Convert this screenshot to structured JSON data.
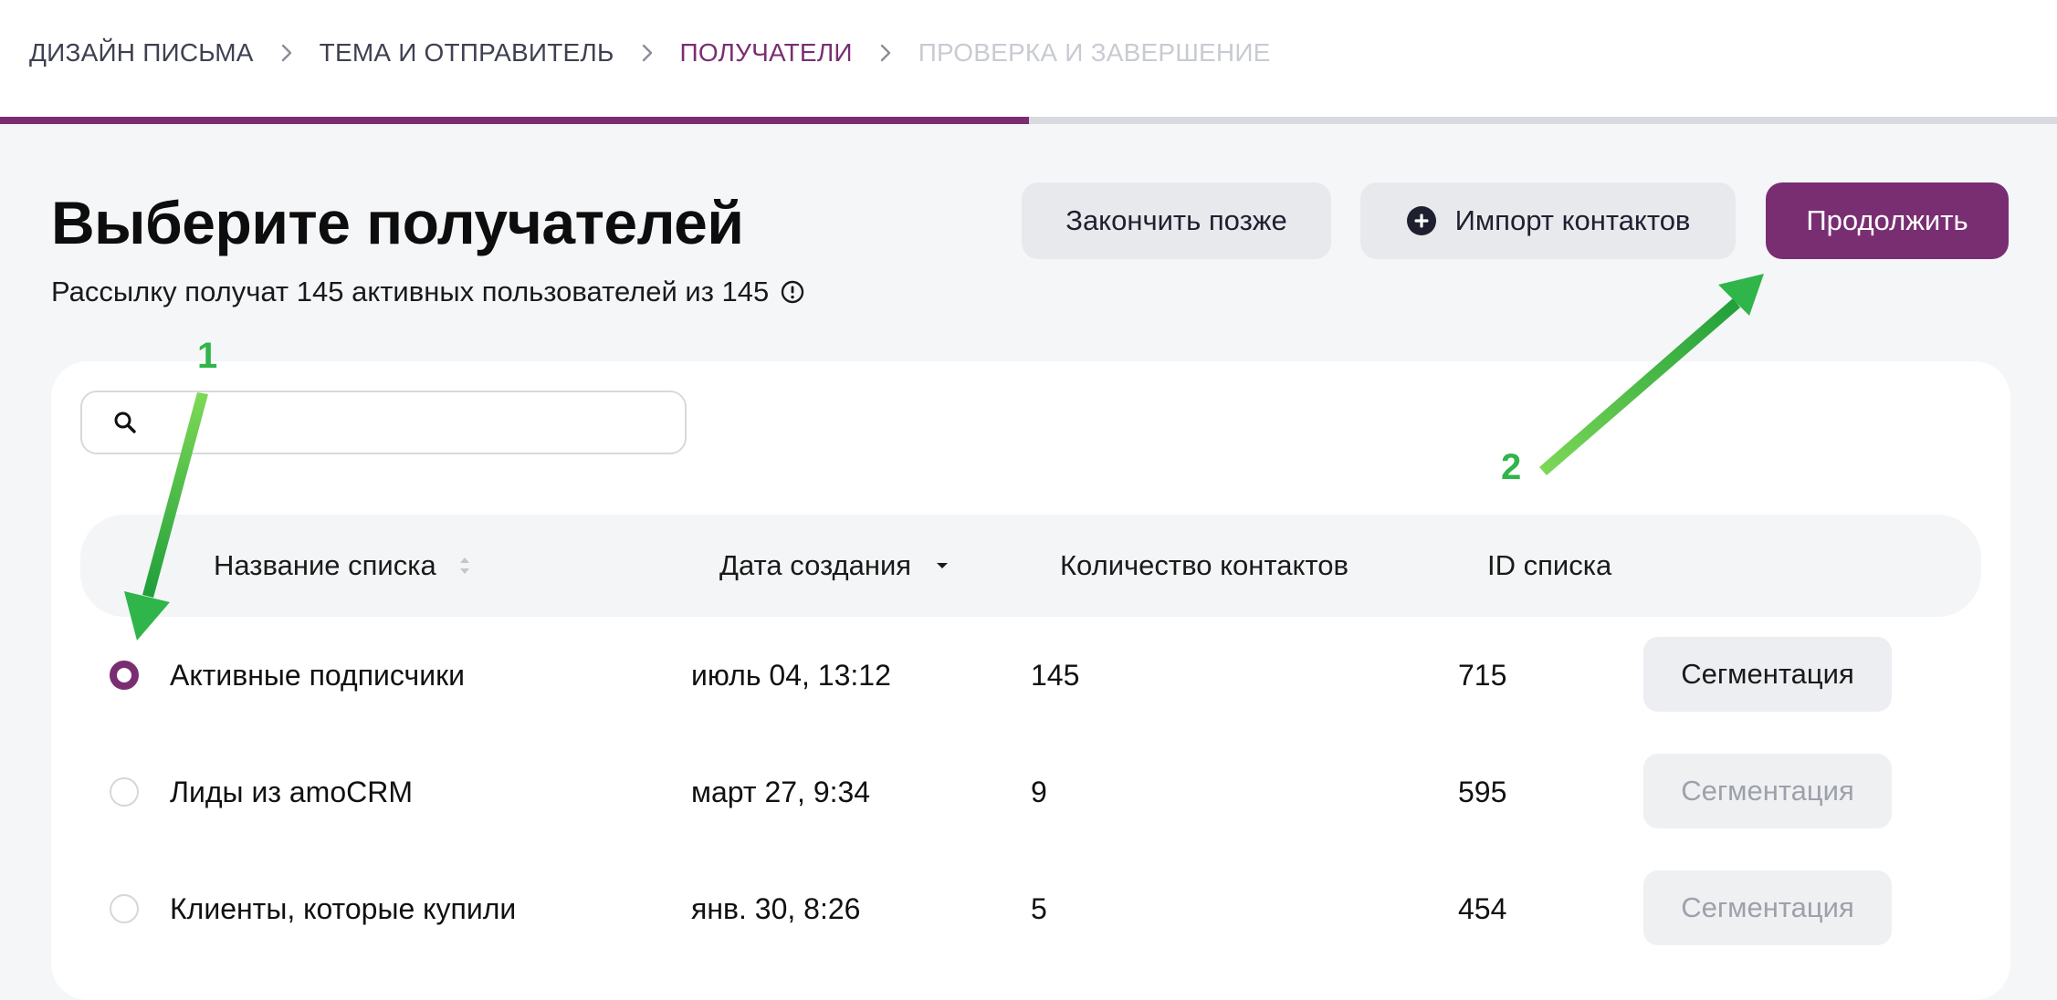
{
  "stepper": {
    "steps": [
      {
        "label": "ДИЗАЙН ПИСЬМА",
        "state": "done"
      },
      {
        "label": "ТЕМА И ОТПРАВИТЕЛЬ",
        "state": "done"
      },
      {
        "label": "ПОЛУЧАТЕЛИ",
        "state": "active"
      },
      {
        "label": "ПРОВЕРКА И ЗАВЕРШЕНИЕ",
        "state": "todo"
      }
    ],
    "separator_icon": "chevron-right-icon",
    "progress_fraction": 0.5
  },
  "page": {
    "title": "Выберите получателей",
    "subtitle": "Рассылку получат 145 активных пользователей из 145",
    "info_icon": "info-icon"
  },
  "actions": {
    "later_label": "Закончить позже",
    "import_label": "Импорт контактов",
    "import_icon": "plus-circle-icon",
    "continue_label": "Продолжить"
  },
  "search": {
    "icon": "search-icon",
    "placeholder": "",
    "value": ""
  },
  "table": {
    "columns": {
      "name": "Название списка",
      "date": "Дата создания",
      "count": "Количество контактов",
      "id": "ID списка"
    },
    "rows": [
      {
        "selected": true,
        "name": "Активные подписчики",
        "date": "июль 04, 13:12",
        "count": "145",
        "id": "715",
        "segment_label": "Сегментация",
        "segment_enabled": true
      },
      {
        "selected": false,
        "name": "Лиды из amoCRM",
        "date": "март 27, 9:34",
        "count": "9",
        "id": "595",
        "segment_label": "Сегментация",
        "segment_enabled": false
      },
      {
        "selected": false,
        "name": "Клиенты, которые купили",
        "date": "янв. 30, 8:26",
        "count": "5",
        "id": "454",
        "segment_label": "Сегментация",
        "segment_enabled": false
      }
    ]
  },
  "annotations": {
    "label_1": "1",
    "label_2": "2",
    "color": "#2fb54a"
  },
  "colors": {
    "accent": "#7a2e72",
    "background": "#f5f6f8",
    "button_secondary": "#e8e9ed"
  }
}
